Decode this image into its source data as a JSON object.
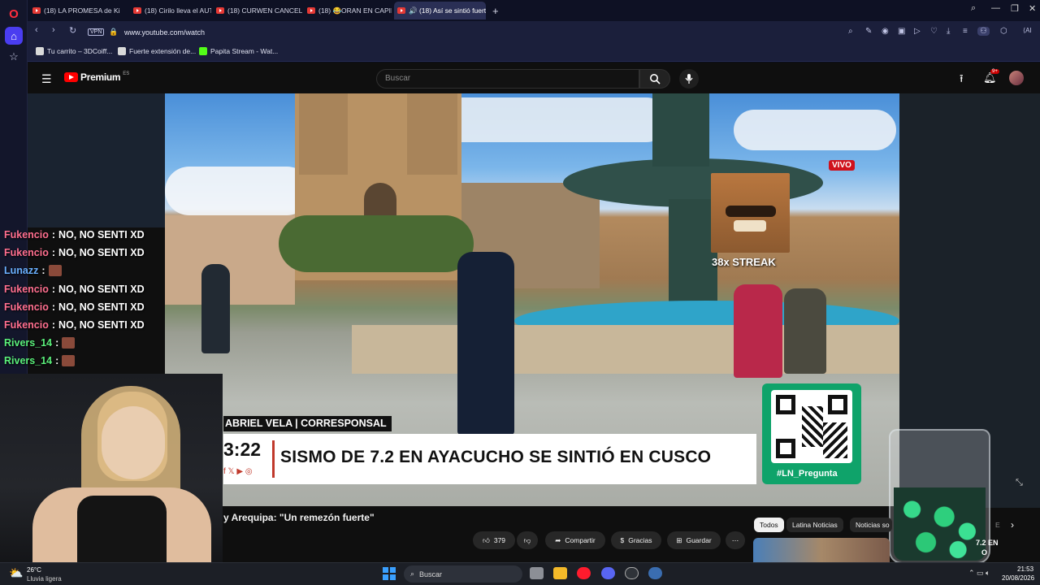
{
  "tabs": [
    {
      "label": "(18) LA PROMESA de King"
    },
    {
      "label": "(18) Cirilo lleva el AUTO p"
    },
    {
      "label": "(18) CURWEN CANCELA L"
    },
    {
      "label": "(18) 😂ORAN EN CAPILLA"
    },
    {
      "label": "🔊 (18) Así se sintió fuert",
      "active": true
    }
  ],
  "address": {
    "url": "www.youtube.com/watch",
    "vpn": "VPN"
  },
  "toolbar": {
    "ai_label": "AI"
  },
  "bookmarks": [
    {
      "label": "Tu carrito – 3DCoiff..."
    },
    {
      "label": "Fuerte extensión de..."
    },
    {
      "label": "Papita Stream - Wat..."
    }
  ],
  "youtube": {
    "logo": "Premium",
    "region": "ES",
    "search_placeholder": "Buscar",
    "notif_count": "9+"
  },
  "chat": [
    {
      "user": "Fukencio",
      "msg": "NO, NO SENTI XD",
      "color": "#ff6f8f"
    },
    {
      "user": "Fukencio",
      "msg": "NO, NO SENTI XD",
      "color": "#ff6f8f"
    },
    {
      "user": "Lunazz",
      "msg": "",
      "color": "#6ab0ff",
      "emote": true
    },
    {
      "user": "Fukencio",
      "msg": "NO, NO SENTI XD",
      "color": "#ff6f8f"
    },
    {
      "user": "Fukencio",
      "msg": "NO, NO SENTI XD",
      "color": "#ff6f8f"
    },
    {
      "user": "Fukencio",
      "msg": "NO, NO SENTI XD",
      "color": "#ff6f8f"
    },
    {
      "user": "Rivers_14",
      "msg": "",
      "color": "#5af07a",
      "emote": true
    },
    {
      "user": "Rivers_14",
      "msg": "",
      "color": "#5af07a",
      "emote": true
    }
  ],
  "video": {
    "live_badge": "VIVO",
    "streak": "38x STREAK",
    "reporter": "ABRIEL VELA | CORRESPONSAL",
    "time": "3:22",
    "headline": "SISMO DE 7.2 EN AYACUCHO SE SINTIÓ EN CUSCO",
    "hashtag": "#LN_Pregunta",
    "title": "y Arequipa: \"Un remezón fuerte\""
  },
  "actions": {
    "likes": "379",
    "share": "Compartir",
    "thanks": "Gracias",
    "save": "Guardar"
  },
  "chips": [
    "Todos",
    "Latina Noticias",
    "Noticias so",
    "E"
  ],
  "related": {
    "snippet_1": "7.2 EN",
    "snippet_2": "O"
  },
  "weather": {
    "temp": "26°C",
    "desc": "Lluvia ligera"
  },
  "taskbar": {
    "search": "Buscar"
  },
  "clock": {
    "time": "21:53",
    "date": "20/08/2026"
  }
}
